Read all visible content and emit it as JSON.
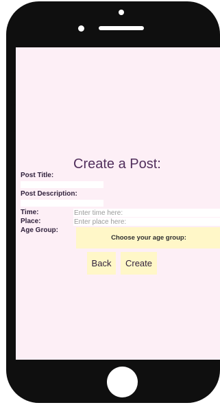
{
  "form": {
    "title": "Create a Post:",
    "post_title_label": "Post Title:",
    "post_description_label": "Post Description:",
    "time_label": "Time:",
    "time_placeholder": "Enter time here:",
    "place_label": "Place:",
    "place_placeholder": "Enter place here:",
    "age_group_label": "Age Group:",
    "age_group_select": "Choose your age group:"
  },
  "actions": {
    "back_label": "Back",
    "create_label": "Create"
  },
  "colors": {
    "screen_background": "#fdeff6",
    "button_background": "#fff7c8",
    "title_color": "#512f5c",
    "device_frame": "#0f0f0f"
  }
}
